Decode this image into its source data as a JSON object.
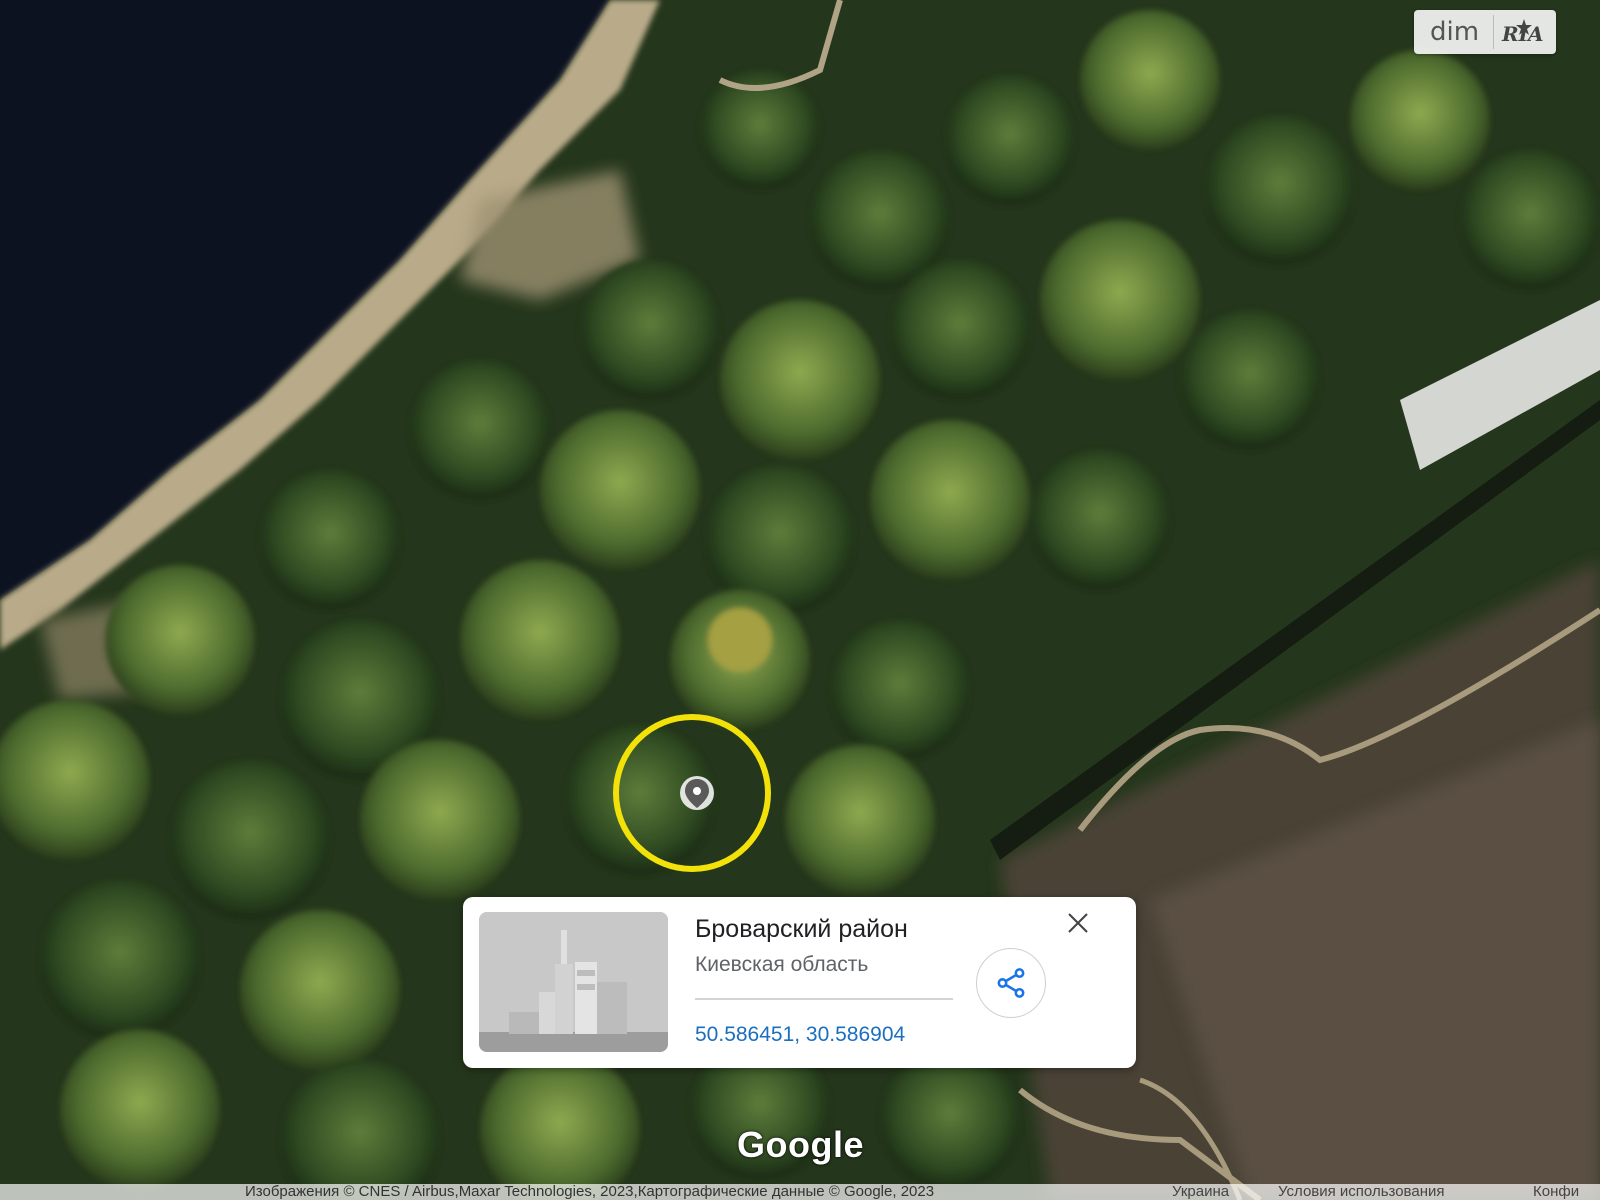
{
  "watermark": {
    "text": "dim",
    "logo_text": "RIA"
  },
  "map": {
    "type": "satellite",
    "marker_ring_color": "#f2e20a"
  },
  "place_card": {
    "title": "Броварский район",
    "subtitle": "Киевская область",
    "coordinates": "50.586451, 30.586904",
    "coords_color": "#1a6fbf",
    "share_icon": "share-icon",
    "close_icon": "close-icon",
    "thumbnail_icon": "building-placeholder-icon"
  },
  "google_logo": "Google",
  "attribution": {
    "imagery": "Изображения © CNES / Airbus,Maxar Technologies, 2023,Картографические данные © Google, 2023",
    "country": "Украина",
    "terms": "Условия использования",
    "privacy": "Конфи"
  }
}
